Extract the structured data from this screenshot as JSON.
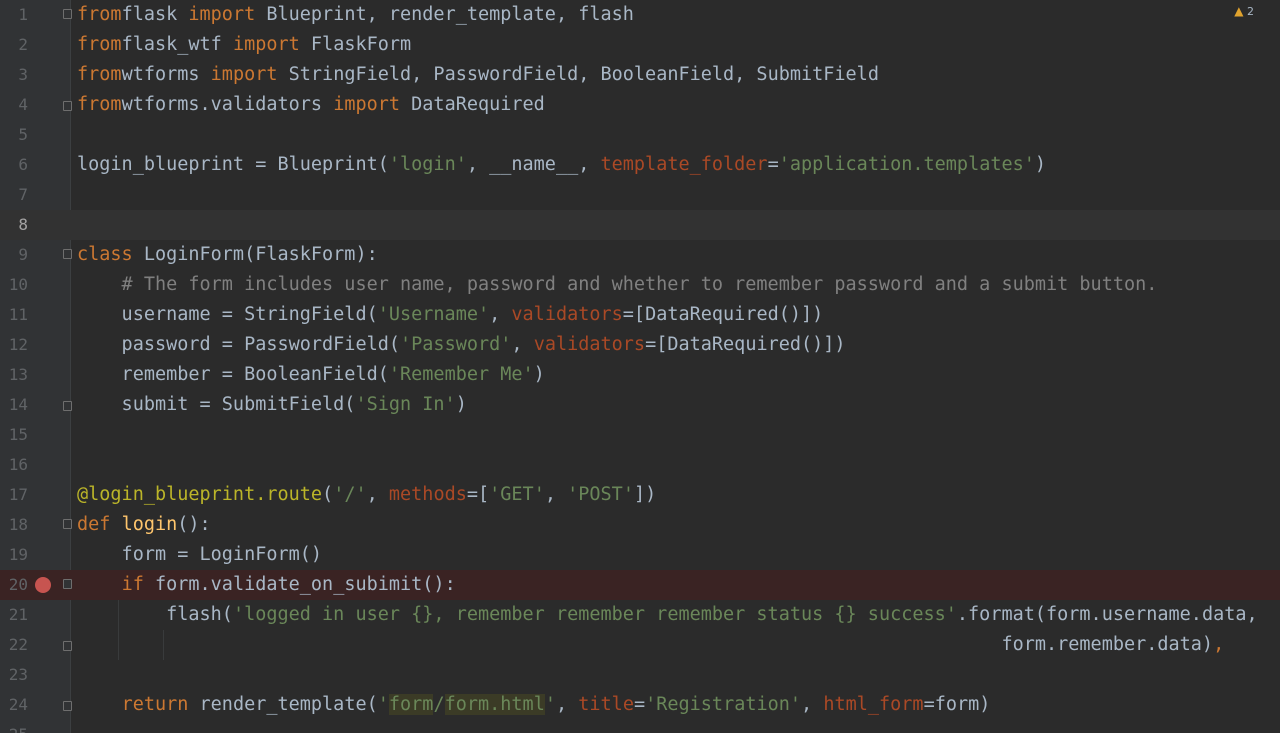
{
  "editor": {
    "warnings": {
      "icon": "warning-icon",
      "count": "2",
      "color": "#e0a32e"
    },
    "current_line": 8,
    "breakpoint_line": 20,
    "lines": [
      {
        "n": "1",
        "tokens": [
          [
            "k",
            "from"
          ],
          [
            "",
            "flask "
          ],
          [
            "k",
            "import "
          ],
          [
            "",
            "Blueprint, render_template, flash"
          ]
        ]
      },
      {
        "n": "2",
        "tokens": [
          [
            "k",
            "from"
          ],
          [
            "",
            "flask_wtf "
          ],
          [
            "k",
            "import "
          ],
          [
            "",
            "FlaskForm"
          ]
        ]
      },
      {
        "n": "3",
        "tokens": [
          [
            "k",
            "from"
          ],
          [
            "",
            "wtforms "
          ],
          [
            "k",
            "import "
          ],
          [
            "",
            "StringField, PasswordField, BooleanField, SubmitField"
          ]
        ]
      },
      {
        "n": "4",
        "tokens": [
          [
            "k",
            "from"
          ],
          [
            "",
            "wtforms.validators "
          ],
          [
            "k",
            "import "
          ],
          [
            "",
            "DataRequired"
          ]
        ]
      },
      {
        "n": "5",
        "tokens": []
      },
      {
        "n": "6",
        "tokens": [
          [
            "",
            "login_blueprint = Blueprint("
          ],
          [
            "s",
            "'login'"
          ],
          [
            "",
            ", __name__, "
          ],
          [
            "p",
            "template_folder"
          ],
          [
            "",
            "="
          ],
          [
            "s",
            "'application.templates'"
          ],
          [
            "",
            ")"
          ]
        ]
      },
      {
        "n": "7",
        "tokens": []
      },
      {
        "n": "8",
        "tokens": []
      },
      {
        "n": "9",
        "tokens": [
          [
            "k",
            "class "
          ],
          [
            "",
            "LoginForm(FlaskForm):"
          ]
        ]
      },
      {
        "n": "10",
        "tokens": [
          [
            "c",
            "    # The form includes user name, password and whether to remember password and a submit button."
          ]
        ]
      },
      {
        "n": "11",
        "tokens": [
          [
            "",
            "    username = StringField("
          ],
          [
            "s",
            "'Username'"
          ],
          [
            "",
            ", "
          ],
          [
            "p",
            "validators"
          ],
          [
            "",
            "=[DataRequired()])"
          ]
        ]
      },
      {
        "n": "12",
        "tokens": [
          [
            "",
            "    password = PasswordField("
          ],
          [
            "s",
            "'Password'"
          ],
          [
            "",
            ", "
          ],
          [
            "p",
            "validators"
          ],
          [
            "",
            "=[DataRequired()])"
          ]
        ]
      },
      {
        "n": "13",
        "tokens": [
          [
            "",
            "    remember = BooleanField("
          ],
          [
            "s",
            "'Remember Me'"
          ],
          [
            "",
            ")"
          ]
        ]
      },
      {
        "n": "14",
        "tokens": [
          [
            "",
            "    submit = SubmitField("
          ],
          [
            "s",
            "'Sign In'"
          ],
          [
            "",
            ")"
          ]
        ]
      },
      {
        "n": "15",
        "tokens": []
      },
      {
        "n": "16",
        "tokens": []
      },
      {
        "n": "17",
        "tokens": [
          [
            "d",
            "@login_blueprint.route"
          ],
          [
            "",
            "("
          ],
          [
            "s",
            "'/'"
          ],
          [
            "",
            ", "
          ],
          [
            "p",
            "methods"
          ],
          [
            "",
            "=["
          ],
          [
            "s",
            "'GET'"
          ],
          [
            "",
            ", "
          ],
          [
            "s",
            "'POST'"
          ],
          [
            "",
            "])"
          ]
        ]
      },
      {
        "n": "18",
        "tokens": [
          [
            "k",
            "def "
          ],
          [
            "f",
            "login"
          ],
          [
            "",
            "():"
          ]
        ]
      },
      {
        "n": "19",
        "tokens": [
          [
            "",
            "    form = LoginForm()"
          ]
        ]
      },
      {
        "n": "20",
        "tokens": [
          [
            "",
            "    "
          ],
          [
            "k",
            "if "
          ],
          [
            "",
            "form.validate_on_subimit():"
          ]
        ]
      },
      {
        "n": "21",
        "tokens": [
          [
            "",
            "        flash("
          ],
          [
            "s",
            "'logged in user {}, remember remember remember status {} success'"
          ],
          [
            "",
            ".format(form.username.data,"
          ]
        ]
      },
      {
        "n": "22",
        "tokens": [
          [
            "",
            "                                                                                   form.remember.data)"
          ],
          [
            "k",
            ","
          ]
        ]
      },
      {
        "n": "23",
        "tokens": []
      },
      {
        "n": "24",
        "tokens": [
          [
            "",
            "    "
          ],
          [
            "k",
            "return "
          ],
          [
            "",
            "render_template("
          ],
          [
            "s",
            "'"
          ],
          [
            "s hl",
            "form"
          ],
          [
            "s",
            "/"
          ],
          [
            "s hl",
            "form.html"
          ],
          [
            "s",
            "'"
          ],
          [
            "",
            ", "
          ],
          [
            "p",
            "title"
          ],
          [
            "",
            "="
          ],
          [
            "s",
            "'Registration'"
          ],
          [
            "",
            ", "
          ],
          [
            "p",
            "html_form"
          ],
          [
            "",
            "=form)"
          ]
        ]
      },
      {
        "n": "25",
        "tokens": []
      }
    ]
  }
}
